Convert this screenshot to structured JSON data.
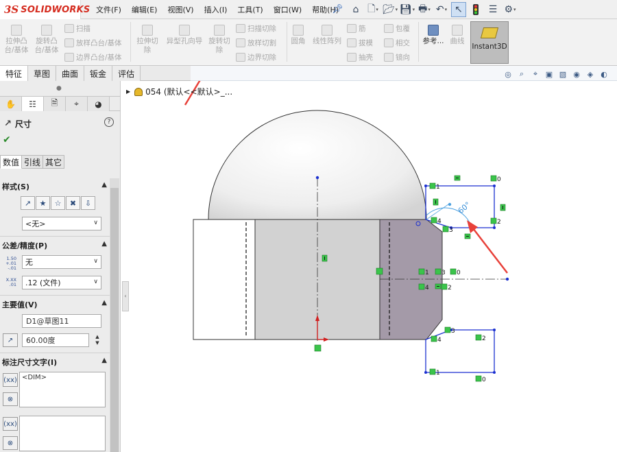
{
  "app": {
    "brand_ds": "3S",
    "brand_name": "SOLIDWORKS"
  },
  "menu": [
    "文件(F)",
    "编辑(E)",
    "视图(V)",
    "插入(I)",
    "工具(T)",
    "窗口(W)",
    "帮助(H)"
  ],
  "ribbon": {
    "extrude_boss": "拉伸凸台/基体",
    "revolve_boss": "旋转凸台/基体",
    "sweep": "扫描",
    "loft_boss": "放样凸台/基体",
    "boundary_boss": "边界凸台/基体",
    "extrude_cut": "拉伸切除",
    "hole_wizard": "异型孔向导",
    "revolve_cut": "旋转切除",
    "swept_cut": "扫描切除",
    "lofted_cut": "放样切割",
    "boundary_cut": "边界切除",
    "fillet": "圆角",
    "linear_pattern": "线性阵列",
    "rib": "筋",
    "wrap": "包覆",
    "draft": "拔模",
    "intersect": "相交",
    "shell": "抽壳",
    "mirror": "镜向",
    "reference": "参考...",
    "curves": "曲线",
    "instant3d": "Instant3D"
  },
  "tabs": [
    "特征",
    "草图",
    "曲面",
    "钣金",
    "评估"
  ],
  "tree": {
    "part_name": "054 (默认<<默认>_..."
  },
  "property_manager": {
    "title": "尺寸",
    "subtabs": [
      "数值",
      "引线",
      "其它"
    ],
    "style_section": "样式(S)",
    "style_value": "<无>",
    "tolerance_section": "公差/精度(P)",
    "tolerance_type": "无",
    "tol_icon_top": "1.50",
    "tol_icon_sub1": "+.01",
    "tol_icon_sub2": "-.01",
    "precision_icon_top": "X.XX",
    "precision_icon_sub": ".01",
    "precision_value": ".12 (文件)",
    "primary_section": "主要值(V)",
    "primary_name": "D1@草图11",
    "primary_value": "60.00度",
    "dimtext_section": "标注尺寸文字(I)",
    "dim_text": "<DIM>"
  },
  "sketch": {
    "angle_dimension": "60°",
    "relations": [
      "0",
      "1",
      "2",
      "3",
      "4"
    ]
  },
  "colors": {
    "brand_red": "#d52b1e",
    "relation_green": "#3bc44b",
    "sketch_blue": "#1a2fd0",
    "annotation_arrow": "#e8413a",
    "dimension_cyan": "#4aa0e0"
  }
}
